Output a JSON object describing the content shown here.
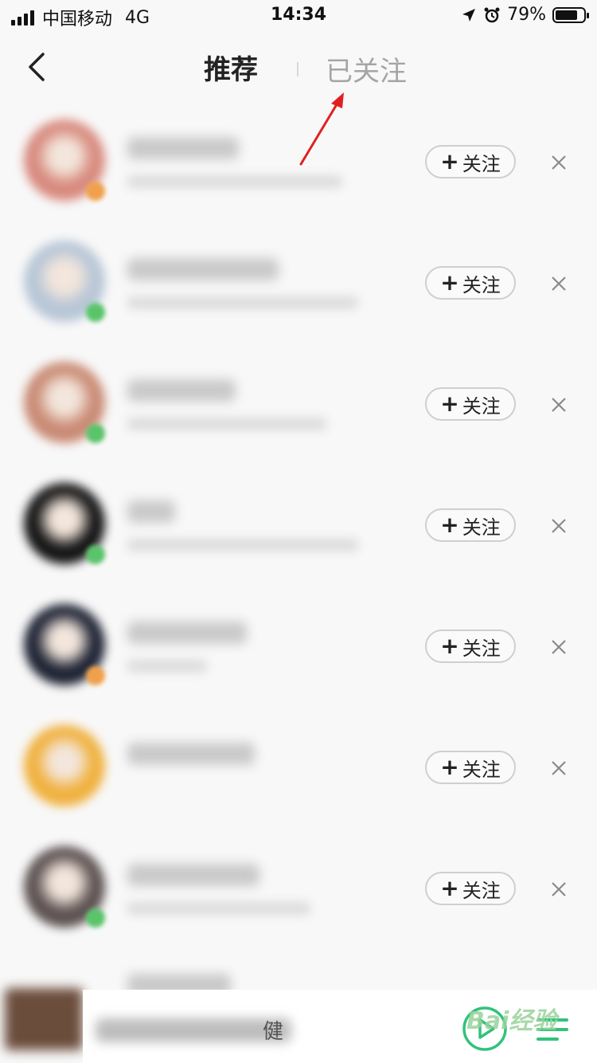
{
  "status_bar": {
    "carrier": "中国移动",
    "network": "4G",
    "time": "14:34",
    "battery_percent": "79%",
    "battery_level": 0.79
  },
  "nav": {
    "back_icon": "chevron-left-icon",
    "tab_recommend": "推荐",
    "tab_followed": "已关注"
  },
  "list": {
    "follow_label": "关注",
    "plus_symbol": "+",
    "dismiss_icon": "close-icon",
    "avatar_colors": [
      "#d88a7e",
      "#b7c6d6",
      "#c98a74",
      "#151515",
      "#1f2434",
      "#f0b13f",
      "#5d5252"
    ],
    "badge_colors": [
      "#f0a04a",
      "#59c46a",
      "#59c46a",
      "#59c46a",
      "#f0a04a",
      "",
      "#59c46a"
    ]
  },
  "player": {
    "title_suffix": "健",
    "play_icon": "play-circle-icon",
    "playlist_icon": "playlist-icon"
  },
  "watermark": {
    "text": "Bai经验"
  },
  "colors": {
    "accent_green": "#31c27c",
    "annotation_red": "#e02020"
  }
}
